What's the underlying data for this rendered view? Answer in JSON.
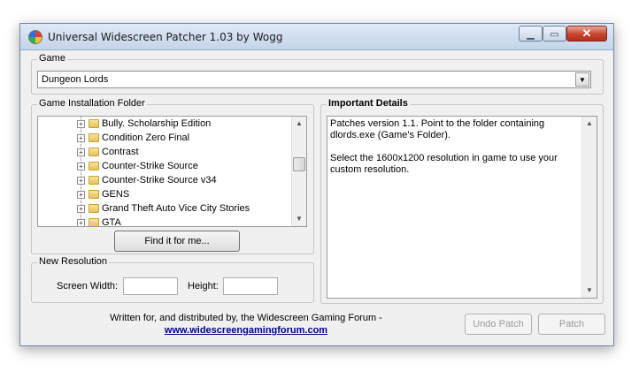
{
  "window": {
    "title": "Universal Widescreen Patcher 1.03 by Wogg",
    "controls": {
      "minimize": "▁",
      "maximize": "▭",
      "close": "✕"
    }
  },
  "game": {
    "legend": "Game",
    "selected": "Dungeon Lords"
  },
  "install_folder": {
    "legend": "Game Installation Folder",
    "items": [
      "Bully. Scholarship Edition",
      "Condition Zero Final",
      "Contrast",
      "Counter-Strike Source",
      "Counter-Strike Source v34",
      "GENS",
      "Grand Theft Auto Vice City Stories",
      "GTA"
    ],
    "find_button": "Find it for me..."
  },
  "resolution": {
    "legend": "New Resolution",
    "width_label": "Screen Width:",
    "width_value": "",
    "height_label": "Height:",
    "height_value": ""
  },
  "details": {
    "legend": "Important Details",
    "paragraphs": [
      "Patches version 1.1. Point to the folder containing dlords.exe (Game's Folder).",
      "Select the 1600x1200 resolution in game to use your custom resolution."
    ]
  },
  "footer": {
    "text": "Written for, and distributed by, the Widescreen Gaming Forum -",
    "link": "www.widescreengamingforum.com"
  },
  "buttons": {
    "undo": "Undo Patch",
    "patch": "Patch"
  },
  "icons": {
    "app": "app-globe-icon",
    "combo_arrow": "▼",
    "scroll_up": "▲",
    "scroll_down": "▼",
    "tree_expand": "+"
  }
}
